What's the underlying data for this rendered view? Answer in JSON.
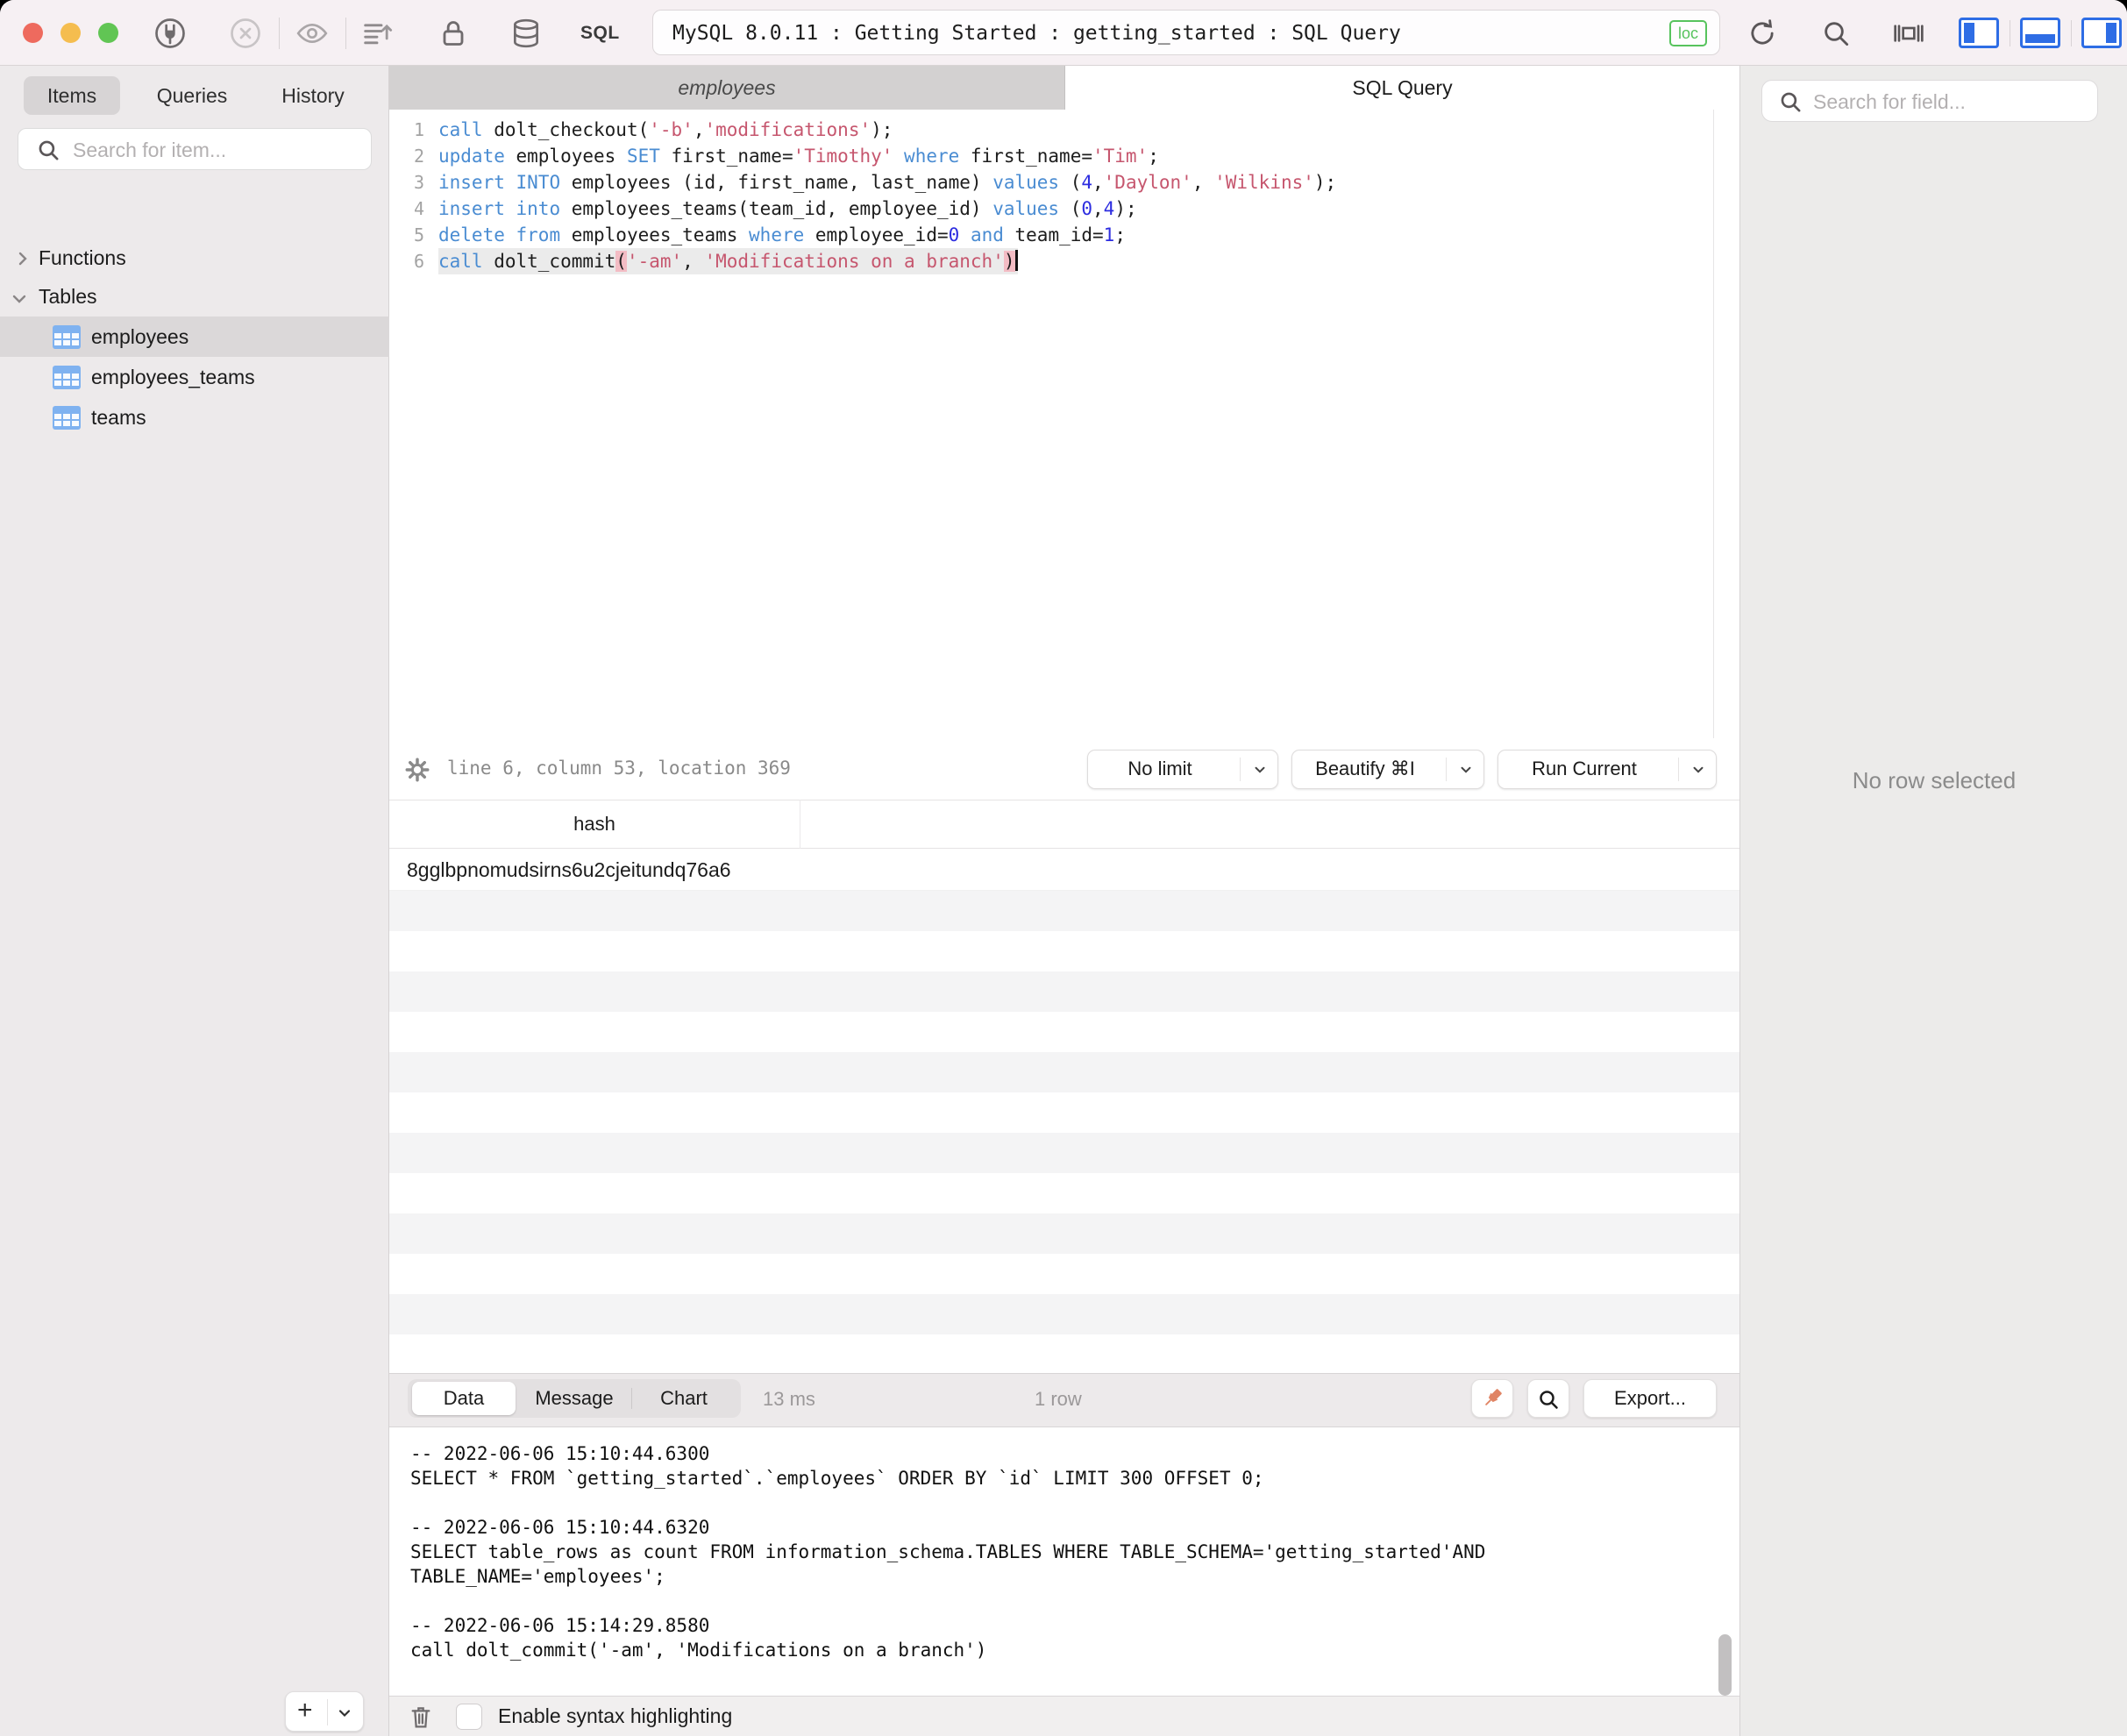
{
  "window": {
    "title": "MySQL 8.0.11 : Getting Started : getting_started : SQL Query",
    "badge": "loc",
    "sql_label": "SQL",
    "colors": {
      "traffic_red": "#ee6a5e",
      "traffic_yellow": "#f5bd4f",
      "traffic_green": "#61c554",
      "accent_blue": "#2e6de5",
      "loc_green": "#57c35d",
      "pin_coral": "#e08464",
      "keyword_blue": "#4a8cd2",
      "string_rose": "#c6566e",
      "number_blue": "#2d2de0"
    }
  },
  "sidebar": {
    "tabs": [
      "Items",
      "Queries",
      "History"
    ],
    "active_tab": "Items",
    "search_placeholder": "Search for item...",
    "tree": {
      "functions_label": "Functions",
      "tables_label": "Tables",
      "tables": [
        "employees",
        "employees_teams",
        "teams"
      ],
      "selected_table": "employees"
    },
    "add_button_label": "+"
  },
  "editor": {
    "tabs": [
      {
        "label": "employees",
        "active": false
      },
      {
        "label": "SQL Query",
        "active": true
      }
    ],
    "status_text": "line 6, column 53, location 369",
    "buttons": [
      {
        "label": "No limit"
      },
      {
        "label": "Beautify ⌘I"
      },
      {
        "label": "Run Current"
      }
    ],
    "lines": [
      {
        "no": 1,
        "tokens": [
          {
            "c": "kw",
            "t": "call"
          },
          {
            "c": "pl",
            "t": " dolt_checkout("
          },
          {
            "c": "str",
            "t": "'-b'"
          },
          {
            "c": "pl",
            "t": ","
          },
          {
            "c": "str",
            "t": "'modifications'"
          },
          {
            "c": "pl",
            "t": ");"
          }
        ]
      },
      {
        "no": 2,
        "tokens": [
          {
            "c": "kw",
            "t": "update"
          },
          {
            "c": "pl",
            "t": " employees "
          },
          {
            "c": "kw",
            "t": "SET"
          },
          {
            "c": "pl",
            "t": " first_name="
          },
          {
            "c": "str",
            "t": "'Timothy'"
          },
          {
            "c": "pl",
            "t": " "
          },
          {
            "c": "kw",
            "t": "where"
          },
          {
            "c": "pl",
            "t": " first_name="
          },
          {
            "c": "str",
            "t": "'Tim'"
          },
          {
            "c": "pl",
            "t": ";"
          }
        ]
      },
      {
        "no": 3,
        "tokens": [
          {
            "c": "kw",
            "t": "insert"
          },
          {
            "c": "pl",
            "t": " "
          },
          {
            "c": "kw",
            "t": "INTO"
          },
          {
            "c": "pl",
            "t": " employees (id, first_name, last_name) "
          },
          {
            "c": "kw",
            "t": "values"
          },
          {
            "c": "pl",
            "t": " ("
          },
          {
            "c": "num",
            "t": "4"
          },
          {
            "c": "pl",
            "t": ","
          },
          {
            "c": "str",
            "t": "'Daylon'"
          },
          {
            "c": "pl",
            "t": ", "
          },
          {
            "c": "str",
            "t": "'Wilkins'"
          },
          {
            "c": "pl",
            "t": ");"
          }
        ]
      },
      {
        "no": 4,
        "tokens": [
          {
            "c": "kw",
            "t": "insert"
          },
          {
            "c": "pl",
            "t": " "
          },
          {
            "c": "kw",
            "t": "into"
          },
          {
            "c": "pl",
            "t": " employees_teams(team_id, employee_id) "
          },
          {
            "c": "kw",
            "t": "values"
          },
          {
            "c": "pl",
            "t": " ("
          },
          {
            "c": "num",
            "t": "0"
          },
          {
            "c": "pl",
            "t": ","
          },
          {
            "c": "num",
            "t": "4"
          },
          {
            "c": "pl",
            "t": ");"
          }
        ]
      },
      {
        "no": 5,
        "tokens": [
          {
            "c": "kw",
            "t": "delete"
          },
          {
            "c": "pl",
            "t": " "
          },
          {
            "c": "kw",
            "t": "from"
          },
          {
            "c": "pl",
            "t": " employees_teams "
          },
          {
            "c": "kw",
            "t": "where"
          },
          {
            "c": "pl",
            "t": " employee_id="
          },
          {
            "c": "num",
            "t": "0"
          },
          {
            "c": "pl",
            "t": " "
          },
          {
            "c": "kw",
            "t": "and"
          },
          {
            "c": "pl",
            "t": " team_id="
          },
          {
            "c": "num",
            "t": "1"
          },
          {
            "c": "pl",
            "t": ";"
          }
        ]
      },
      {
        "no": 6,
        "current": true,
        "tokens": [
          {
            "c": "kw",
            "t": "call"
          },
          {
            "c": "pl",
            "t": " dolt_commit"
          },
          {
            "c": "hp",
            "t": "("
          },
          {
            "c": "str",
            "t": "'-am'"
          },
          {
            "c": "pl",
            "t": ", "
          },
          {
            "c": "str",
            "t": "'Modifications on a branch'"
          },
          {
            "c": "hp",
            "t": ")"
          }
        ]
      }
    ]
  },
  "results": {
    "columns": [
      "hash"
    ],
    "rows": [
      [
        "8gglbpnomudsirns6u2cjeitundq76a6"
      ]
    ],
    "empty_row_count": 12
  },
  "bottom_toolbar": {
    "tabs": [
      "Data",
      "Message",
      "Chart"
    ],
    "active_tab": "Data",
    "duration": "13 ms",
    "row_count": "1 row",
    "export_label": "Export..."
  },
  "log": {
    "entries": [
      {
        "timestamp": "-- 2022-06-06 15:10:44.6300",
        "query": "SELECT * FROM `getting_started`.`employees` ORDER BY `id` LIMIT 300 OFFSET 0;"
      },
      {
        "timestamp": "-- 2022-06-06 15:10:44.6320",
        "query": "SELECT table_rows as count FROM information_schema.TABLES WHERE TABLE_SCHEMA='getting_started'AND TABLE_NAME='employees';"
      },
      {
        "timestamp": "-- 2022-06-06 15:14:29.8580",
        "query": "call dolt_commit('-am', 'Modifications on a branch')"
      }
    ],
    "syntax_checkbox_label": "Enable syntax highlighting",
    "syntax_checkbox_checked": false
  },
  "inspector": {
    "search_placeholder": "Search for field...",
    "empty_message": "No row selected"
  }
}
